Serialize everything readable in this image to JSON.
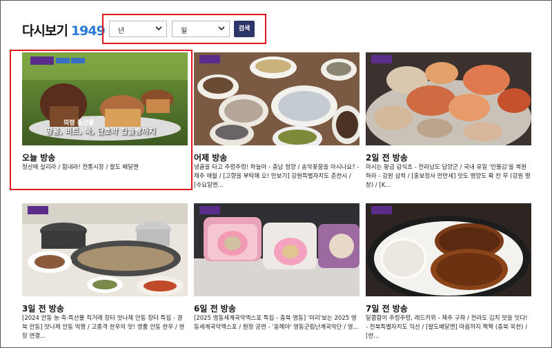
{
  "page": {
    "title": "다시보기",
    "count": "1949"
  },
  "filters": {
    "year_value": "년",
    "month_value": "월",
    "search_label": "검색"
  },
  "episodes": [
    {
      "title": "오늘 방송",
      "desc": "청산에 살리라 / 힘내라! 전통시장 / 팔도 배달맨",
      "caption_line1": "의령 농산물",
      "caption_line2": "땅콩, 비트, 쑥, 단호박 찹쌀빵까지"
    },
    {
      "title": "어제 방송",
      "desc": "냉골을 타고 주렁주렁! 하늘아 - 충남 청양 / 송악꽃꿈을 아시나요? - 제주 애월 / [고향을 부탁해 오! 만보기] 강원특별자치도 춘천시 / [수요일엔..."
    },
    {
      "title": "2일 전 방송",
      "desc": "마시는 황금 감식초 - 전라남도 담양군 / 국내 유일 '민물김'을 복원하라 - 강원 삼척 / [홍보정사 만만세] 맛도 영양도 확 찬 무 (강원 평창) / [K..."
    },
    {
      "title": "3일 전 방송",
      "desc": "[2024 안동 농·축·특산물 직거래 장터 맛나제 안동 장터 특집 - 경북 안동] 맛나제 안동 먹짱 / 고종격 한우의 맛! 명품 안동 한우 / 현장 연결..."
    },
    {
      "title": "6일 전 방송",
      "desc": "[2025 영동세계국악엑스포 특집 - 충북 영동] '미리'보는 2025 영동세계국악엑스포 / 원정 공연 - '옹헤야' 영동군립난계국악단 / 영..."
    },
    {
      "title": "7일 전 방송",
      "desc": "달콤함이 주렁주렁, 레드키위 - 제주 구좌 / 전라도 김치 맛을 잇다! - 전북특별자치도 익산 / [팔도배달맨] 마음까지 짝짝 (충북 옥천) / [한..."
    }
  ]
}
